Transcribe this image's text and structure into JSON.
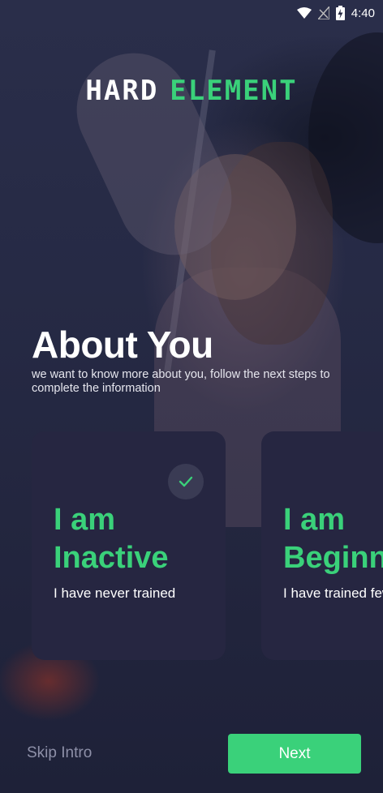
{
  "status_bar": {
    "time": "4:40",
    "battery_level": "8",
    "icons": [
      "wifi-icon",
      "signal-icon",
      "battery-charging-icon"
    ]
  },
  "logo": {
    "part1": "HARD",
    "part2": "ELEMENT",
    "accent_color": "#3ad17a"
  },
  "header": {
    "title": "About You",
    "subtitle": "we want to know more about you, follow the next steps to complete the information"
  },
  "cards": [
    {
      "line1": "I am",
      "line2": "Inactive",
      "description": "I have never trained",
      "selected": true
    },
    {
      "line1": "I am",
      "line2": "Beginner",
      "description": "I have trained few times",
      "selected": false
    }
  ],
  "footer": {
    "skip_label": "Skip Intro",
    "next_label": "Next"
  },
  "colors": {
    "accent": "#3ad17a",
    "card_bg": "#262641",
    "background": "#23263f"
  }
}
